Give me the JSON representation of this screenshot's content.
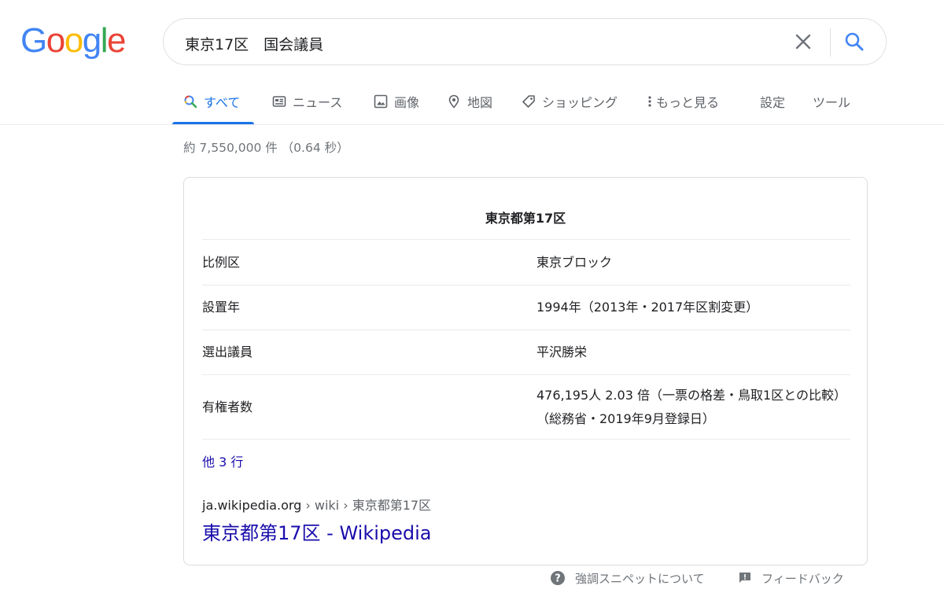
{
  "logo": {
    "letters": [
      "G",
      "o",
      "o",
      "g",
      "l",
      "e"
    ],
    "colors": [
      "#4285f4",
      "#ea4335",
      "#fbbc05",
      "#4285f4",
      "#34a853",
      "#ea4335"
    ]
  },
  "search": {
    "query": "東京17区　国会議員"
  },
  "tabs": [
    {
      "label": "すべて",
      "icon": "search-icon"
    },
    {
      "label": "ニュース",
      "icon": "news-icon"
    },
    {
      "label": "画像",
      "icon": "image-icon"
    },
    {
      "label": "地図",
      "icon": "map-pin-icon"
    },
    {
      "label": "ショッピング",
      "icon": "tag-icon"
    },
    {
      "label": "もっと見る",
      "icon": "more-vert-icon"
    },
    {
      "label": "設定",
      "icon": ""
    },
    {
      "label": "ツール",
      "icon": ""
    }
  ],
  "result_stats": "約 7,550,000 件 （0.64 秒）",
  "snippet": {
    "title": "東京都第17区",
    "rows": [
      {
        "key": "比例区",
        "value": "東京ブロック"
      },
      {
        "key": "設置年",
        "value": "1994年（2013年・2017年区割変更）"
      },
      {
        "key": "選出議員",
        "value": "平沢勝栄"
      },
      {
        "key": "有権者数",
        "value": "476,195人 2.03 倍（一票の格差・鳥取1区との比較）（総務省・2019年9月登録日）"
      }
    ],
    "more_rows": "他 3 行",
    "cite_domain": "ja.wikipedia.org",
    "cite_path": " › wiki › 東京都第17区",
    "result_title": "東京都第17区 - Wikipedia"
  },
  "footer": {
    "about": "強調スニペットについて",
    "feedback": "フィードバック"
  },
  "colors": {
    "accent": "#1a73e8",
    "link": "#1a0dab",
    "muted": "#70757a"
  }
}
